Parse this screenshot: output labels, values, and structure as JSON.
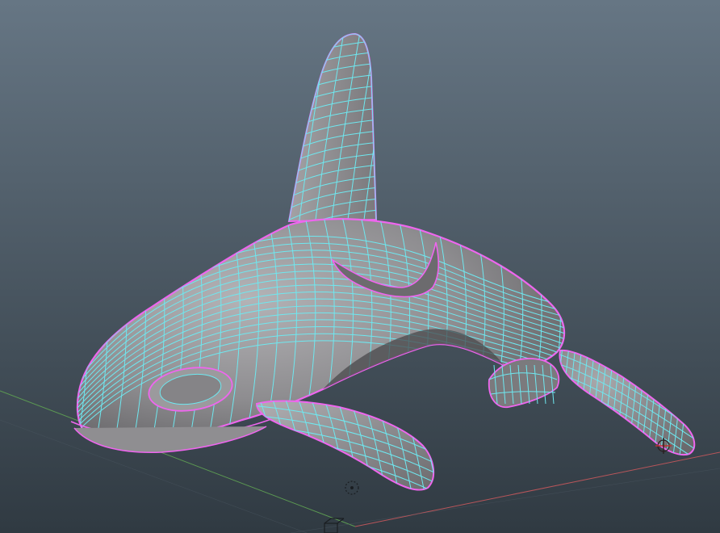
{
  "viewport": {
    "type": "3d-modeling-viewport",
    "background": {
      "top_color": "#667684",
      "bottom_color": "#303a42"
    },
    "model": {
      "name_icon": "orca-whale-mesh",
      "shading": "smooth-shaded-with-wireframe-on-shaded",
      "surface_color": "#8d8c8e",
      "wireframe_color": "#6ee8f0",
      "selection_edge_color": "#ee66ee"
    },
    "grid": {
      "visible": true,
      "axis_x_color": "#b8555a",
      "axis_z_color": "#5c9a52"
    },
    "gizmos": [
      "pivot-icon",
      "rotate-pivot-icon",
      "manipulator-icon"
    ]
  }
}
